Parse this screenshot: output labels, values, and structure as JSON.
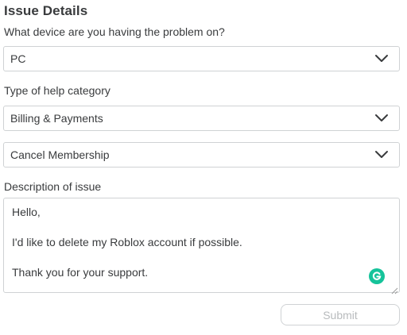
{
  "section_title": "Issue Details",
  "device": {
    "label": "What device are you having the problem on?",
    "selected": "PC"
  },
  "help_category": {
    "label": "Type of help category",
    "selected": "Billing & Payments",
    "sub_selected": "Cancel Membership"
  },
  "description": {
    "label": "Description of issue",
    "lines": [
      "Hello,",
      "I'd like to delete my Roblox account if possible.",
      "Thank you for your support."
    ]
  },
  "grammarly_icon": "grammarly-icon",
  "submit_label": "Submit",
  "colors": {
    "text": "#393b3d",
    "border": "#cfd2d4",
    "disabled_text": "#b8bbbd",
    "grammarly": "#15c39a"
  }
}
